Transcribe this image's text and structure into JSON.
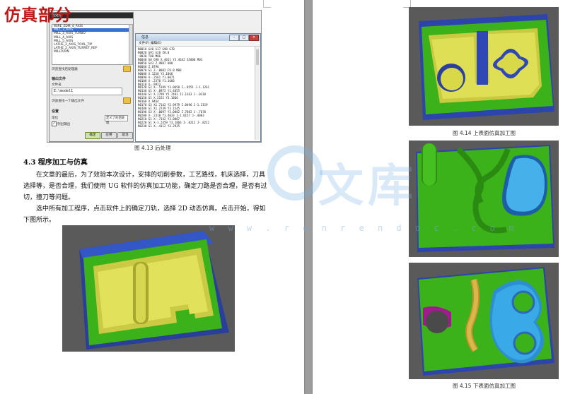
{
  "watermark_title": "仿真部分",
  "watermark": {
    "site": "w w w . r e n r e n d o c . c o m",
    "glyph1": "文",
    "glyph2": "库"
  },
  "dialog": {
    "title": "后处理",
    "postprocessors": [
      "WIRE_EDM_4_AXIS",
      "MILL_3_AXIS",
      "MILL_3_AXIS_TURBO",
      "MILL_4_AXIS",
      "MILL_5_AXIS",
      "LATHE_2_AXIS_TOOL_TIP",
      "LATHE_2_AXIS_TURRET_REF",
      "MILLTURN"
    ],
    "selected_index": 1,
    "browse_post": "浏览查找后处理器",
    "output_section": "输出文件",
    "filename_label": "文件名",
    "filename_value": "E:\\model1",
    "browse_output": "浏览查找一个输出文件",
    "settings_section": "设置",
    "unit_label": "单位",
    "unit_value": "定义了的后处理",
    "list_output_label": "列出输出",
    "ok": "确定",
    "apply": "应用",
    "cancel": "取消"
  },
  "info_window": {
    "title": "信息",
    "menu": "文件(F)     编辑(E)",
    "lines": [
      "N0010 G40 G17 G90 G70",
      "N0020 G91 G28 Z0.0",
      ":0030 T00 M06",
      "N0040 G0 G90 X.4011 Y3.4642 S5000 M03",
      "N0050 G43 Z.9807 H00",
      "N0060 Z.0798",
      "N0070 G1 Z-.0002 F9.8 M08",
      "N0080 X.1250 Y3.1866",
      "N0090 X-.2561 Y1.0071",
      "N0100 X-.2378 Y1.1666",
      "N0110 X-.9923",
      "N0120 G2 X-.5199 Y3.0658 I-.8551 J-1.1261",
      "N0130 G1 X-.0972 Y1.4055",
      "N0140 G1 X.2799 Y2.7493 I1.1163 J-.0318",
      "N0150 G1 X.5152 Y3.1866",
      "N0160 X.9464",
      "N0170 G3 X1.7142 Y2.9979 I.0496 J-1.3119",
      "N0180 G1 X1.2739 Y3.1545",
      "N0190 G3 X-.0097 Y3.0882 I.7882 J-.7678",
      "N0200 X-.2318 Y3.4033 I-1.0157 J-.4003",
      "N0210 G1 X-.7142 Y3.0007",
      "N0220 G1 X-1.2459 Y3.1866 I-.8212 J-.8212",
      "N0230 G1 X-.4112 Y3.2925"
    ]
  },
  "caption_413": "图 4.13 后处理",
  "section_heading": "4.3  程序加工与仿真",
  "paragraphs": [
    "在文章的最后，为了效验本次设计，安排的切削参数，工艺路线，机床选择，刀具选择等，是否合理，我们使用 UG 软件的仿真加工功能，确定刀路是否合理，是否有过切，撞刀等问题。",
    "选中所有加工程序，点击软件上的确定刀轨，选择 2D 动态仿真。点击开始，得如下图所示。"
  ],
  "caption_414": "图 4.14 上表面仿真加工图",
  "caption_415": "图 4.15 下表面仿真加工图",
  "colors": {
    "model_blue": "#2f4fb8",
    "model_green": "#3cb21a",
    "model_yellow": "#d8d848",
    "model_cyan": "#38a8e0",
    "model_magenta": "#b0209a",
    "render_bg": "#5a5a5a"
  }
}
